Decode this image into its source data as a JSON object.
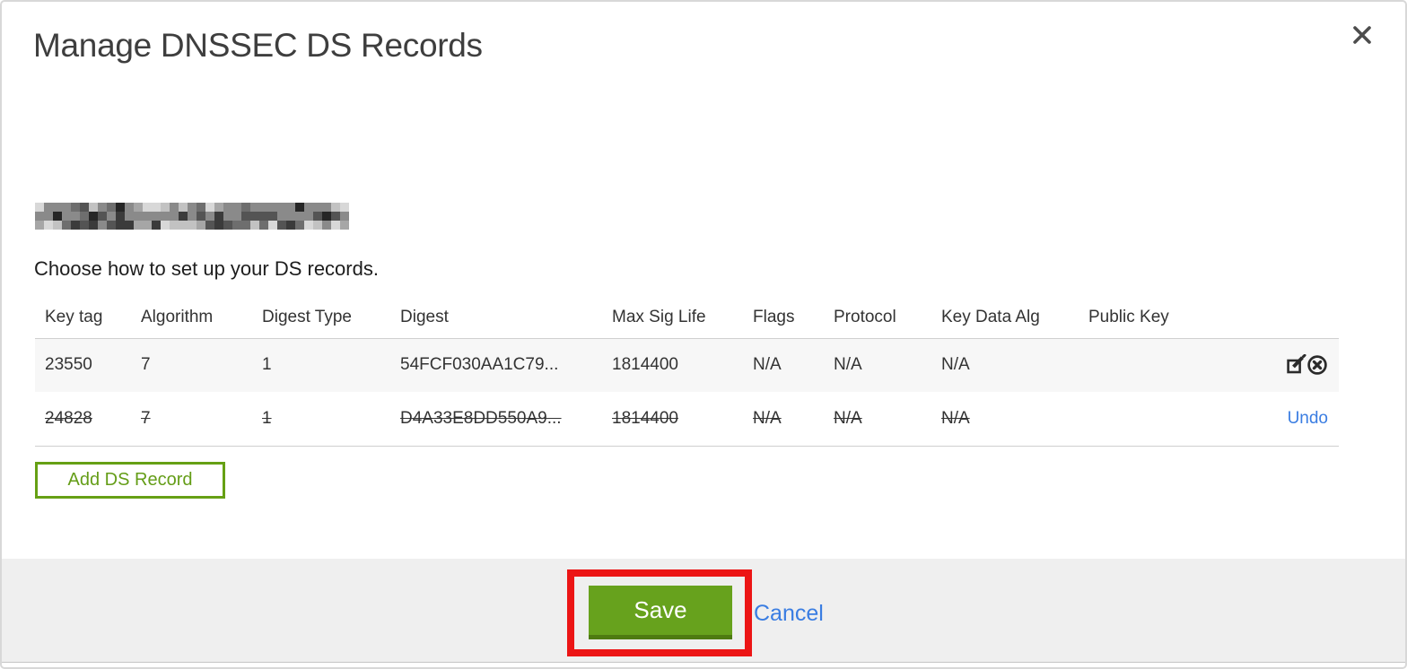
{
  "modal": {
    "title": "Manage DNSSEC DS Records",
    "instruction": "Choose how to set up your DS records."
  },
  "icons": {
    "close": "close-icon",
    "edit": "edit-icon",
    "delete": "delete-circle-x-icon"
  },
  "table": {
    "columns": {
      "key_tag": "Key tag",
      "algorithm": "Algorithm",
      "digest_type": "Digest Type",
      "digest": "Digest",
      "max_sig_life": "Max Sig Life",
      "flags": "Flags",
      "protocol": "Protocol",
      "key_data_alg": "Key Data Alg",
      "public_key": "Public Key"
    },
    "rows": [
      {
        "key_tag": "23550",
        "algorithm": "7",
        "digest_type": "1",
        "digest": "54FCF030AA1C79...",
        "max_sig_life": "1814400",
        "flags": "N/A",
        "protocol": "N/A",
        "key_data_alg": "N/A",
        "public_key": "",
        "state": "active"
      },
      {
        "key_tag": "24828",
        "algorithm": "7",
        "digest_type": "1",
        "digest": "D4A33E8DD550A9...",
        "max_sig_life": "1814400",
        "flags": "N/A",
        "protocol": "N/A",
        "key_data_alg": "N/A",
        "public_key": "",
        "state": "pending-delete",
        "undo_label": "Undo"
      }
    ]
  },
  "buttons": {
    "add_ds_record": "Add DS Record",
    "save": "Save",
    "cancel": "Cancel"
  },
  "annotation": {
    "type": "red-highlight-box",
    "target": "save-button"
  },
  "colors": {
    "accent_green": "#67a21d",
    "add_button_green": "#66a014",
    "link_blue": "#3a7de2",
    "annotation_red": "#ec1515",
    "footer_bg": "#efefef",
    "active_row_bg": "#f7f7f7"
  }
}
